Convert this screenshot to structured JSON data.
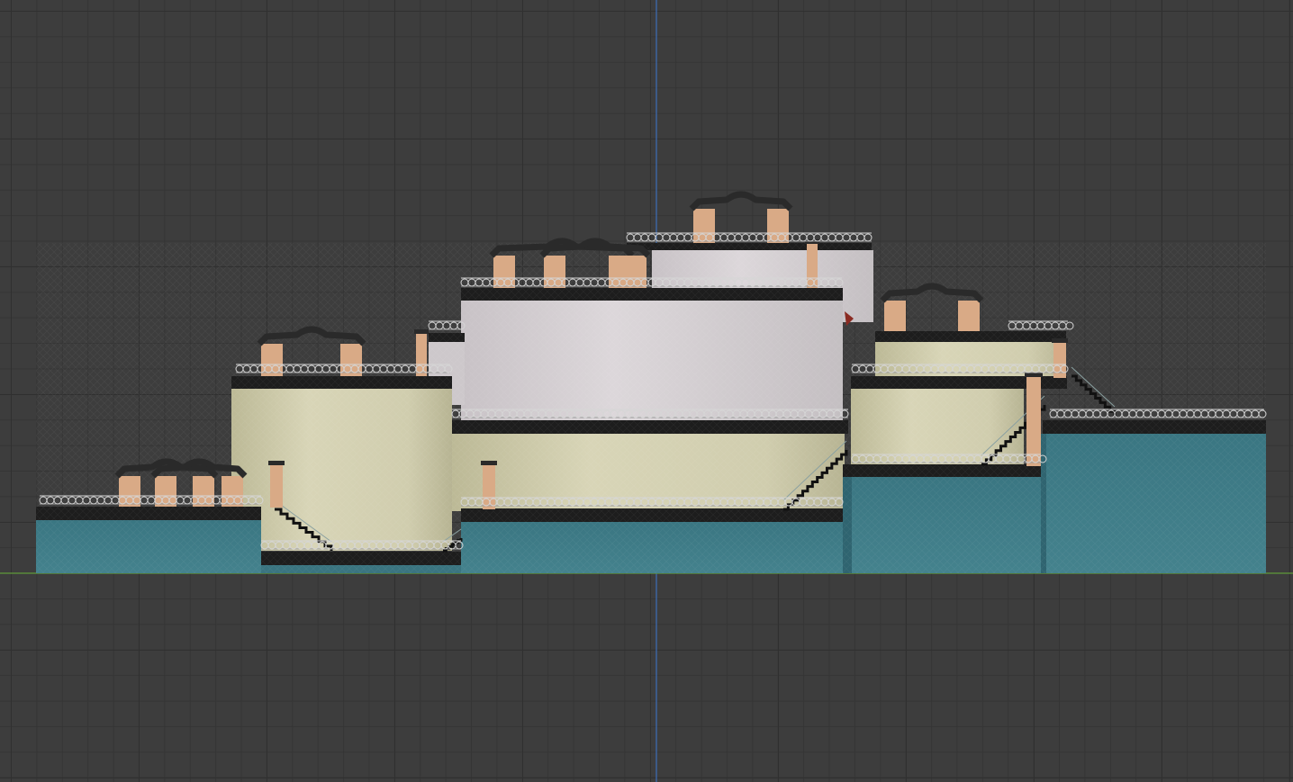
{
  "viewport": {
    "view": "orthographic-front-view",
    "background": "#3d3d3d",
    "grid_minor": "#353535",
    "grid_major": "#303030",
    "axis_z_color": "#3d6db8",
    "axis_x_color": "#5f9a38"
  },
  "model": {
    "object": "terraced-building-with-round-towers",
    "colors": {
      "base_teal": "#3f7d88",
      "base_teal_dark": "#356c77",
      "cream_wall": "#d2cfb0",
      "pale_wall": "#d6d1d3",
      "roof_band": "#1d1d1d",
      "chimney": "#d9aa86",
      "chimney_top": "#2a2a2a",
      "razor_wire": "#d6d6d6"
    }
  }
}
